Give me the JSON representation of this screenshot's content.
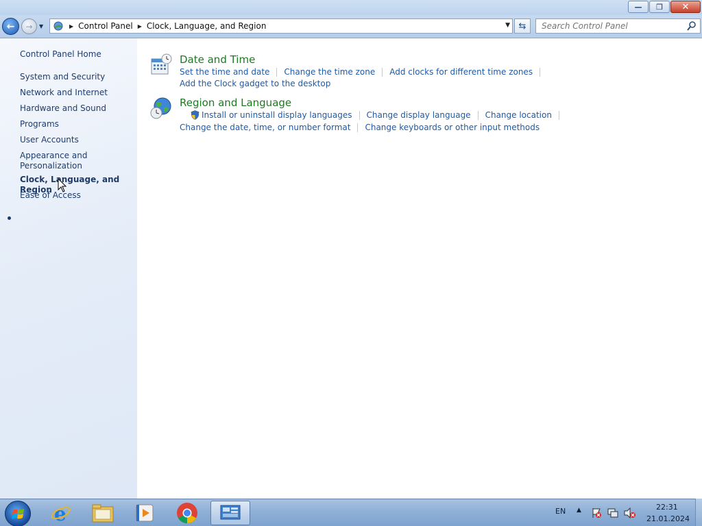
{
  "window": {
    "minimize_glyph": "—",
    "maximize_glyph": "❐",
    "close_glyph": "✕"
  },
  "address": {
    "crumbs": [
      "Control Panel",
      "Clock, Language, and Region"
    ],
    "search_placeholder": "Search Control Panel"
  },
  "sidebar": {
    "home": "Control Panel Home",
    "items": [
      "System and Security",
      "Network and Internet",
      "Hardware and Sound",
      "Programs",
      "User Accounts",
      "Appearance and Personalization",
      "Clock, Language, and Region",
      "Ease of Access"
    ],
    "appearance_line1": "Appearance and",
    "appearance_line2": "Personalization",
    "active_item": "Clock, Language, and Region"
  },
  "categories": [
    {
      "title": "Date and Time",
      "icon": "calendar-clock-icon",
      "links_row1": [
        "Set the time and date",
        "Change the time zone",
        "Add clocks for different time zones"
      ],
      "links_row2": [
        "Add the Clock gadget to the desktop"
      ]
    },
    {
      "title": "Region and Language",
      "icon": "globe-clock-icon",
      "links_row1": [
        "Install or uninstall display languages",
        "Change display language",
        "Change location"
      ],
      "links_row2": [
        "Change the date, time, or number format",
        "Change keyboards or other input methods"
      ]
    }
  ],
  "taskbar": {
    "apps": [
      "internet-explorer-icon",
      "file-explorer-icon",
      "media-player-icon",
      "chrome-icon",
      "control-panel-icon"
    ],
    "language": "EN",
    "time": "22:31",
    "date": "21.01.2024"
  },
  "colors": {
    "link": "#1e5aa8",
    "category_title": "#1d7a21",
    "sidebar_text": "#1e3c6d"
  }
}
